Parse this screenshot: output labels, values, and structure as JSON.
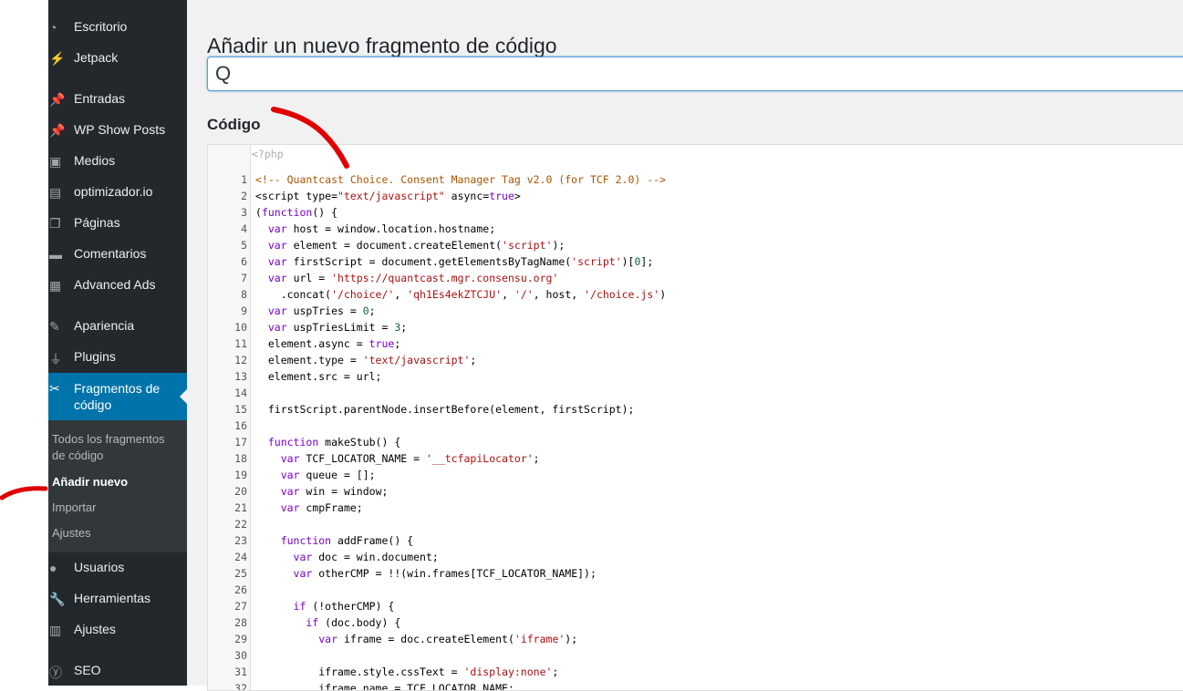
{
  "sidebar": {
    "items": [
      {
        "label": "Escritorio",
        "icon": "dashboard-icon"
      },
      {
        "label": "Jetpack",
        "icon": "jetpack-icon"
      },
      {
        "label": "Entradas",
        "icon": "pin-icon"
      },
      {
        "label": "WP Show Posts",
        "icon": "pin-icon"
      },
      {
        "label": "Medios",
        "icon": "media-icon"
      },
      {
        "label": "optimizador.io",
        "icon": "image-icon"
      },
      {
        "label": "Páginas",
        "icon": "pages-icon"
      },
      {
        "label": "Comentarios",
        "icon": "comment-icon"
      },
      {
        "label": "Advanced Ads",
        "icon": "ads-icon"
      },
      {
        "label": "Apariencia",
        "icon": "brush-icon"
      },
      {
        "label": "Plugins",
        "icon": "plugin-icon"
      },
      {
        "label": "Fragmentos de código",
        "icon": "scissors-icon"
      },
      {
        "label": "Usuarios",
        "icon": "user-icon"
      },
      {
        "label": "Herramientas",
        "icon": "wrench-icon"
      },
      {
        "label": "Ajustes",
        "icon": "settings-icon"
      },
      {
        "label": "SEO",
        "icon": "yoast-icon"
      }
    ],
    "submenu": [
      {
        "label": "Todos los fragmentos de código"
      },
      {
        "label": "Añadir nuevo"
      },
      {
        "label": "Importar"
      },
      {
        "label": "Ajustes"
      }
    ]
  },
  "main": {
    "title": "Añadir un nuevo fragmento de código",
    "title_input_value": "Q",
    "code_heading": "Código",
    "php_open": "<?php"
  },
  "code": [
    "<!-- Quantcast Choice. Consent Manager Tag v2.0 (for TCF 2.0) -->",
    "<script type=\"text/javascript\" async=true>",
    "(function() {",
    "  var host = window.location.hostname;",
    "  var element = document.createElement('script');",
    "  var firstScript = document.getElementsByTagName('script')[0];",
    "  var url = 'https://quantcast.mgr.consensu.org'",
    "    .concat('/choice/', 'qh1Es4ekZTCJU', '/', host, '/choice.js')",
    "  var uspTries = 0;",
    "  var uspTriesLimit = 3;",
    "  element.async = true;",
    "  element.type = 'text/javascript';",
    "  element.src = url;",
    "",
    "  firstScript.parentNode.insertBefore(element, firstScript);",
    "",
    "  function makeStub() {",
    "    var TCF_LOCATOR_NAME = '__tcfapiLocator';",
    "    var queue = [];",
    "    var win = window;",
    "    var cmpFrame;",
    "",
    "    function addFrame() {",
    "      var doc = win.document;",
    "      var otherCMP = !!(win.frames[TCF_LOCATOR_NAME]);",
    "",
    "      if (!otherCMP) {",
    "        if (doc.body) {",
    "          var iframe = doc.createElement('iframe');",
    "",
    "          iframe.style.cssText = 'display:none';",
    "          iframe.name = TCF_LOCATOR_NAME;"
  ],
  "colors": {
    "sidebar_bg": "#23282d",
    "submenu_bg": "#32373c",
    "active_item": "#0073aa",
    "content_bg": "#f1f1f1",
    "annotation": "#e00000"
  }
}
